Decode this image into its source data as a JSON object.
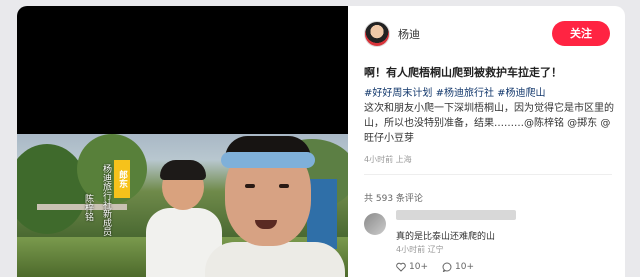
{
  "post": {
    "author": "杨迪",
    "follow_label": "关注",
    "title": "啊！有人爬梧桐山爬到被救护车拉走了！",
    "tags": [
      "#好好周末计划",
      "#杨迪旅行社",
      "#杨迪爬山"
    ],
    "body": "这次和朋友小爬一下深圳梧桐山，因为觉得它是市区里的山，所以也没特别准备，结果………@陈梓铭 @掷东 @旺仔小豆芽",
    "meta": "4小时前 上海"
  },
  "video": {
    "overlay_tag": "郎东",
    "overlay_line": "杨迪旅行社新成员",
    "overlay_name": "陈梓铭"
  },
  "comments": {
    "count_label": "共 593 条评论",
    "items": [
      {
        "text": "真的是比泰山还难爬的山",
        "meta": "4小时前 辽宁",
        "like_label": "10+",
        "reply_label": "10+"
      }
    ]
  },
  "colors": {
    "accent": "#ff2442",
    "tag": "#13386c"
  }
}
